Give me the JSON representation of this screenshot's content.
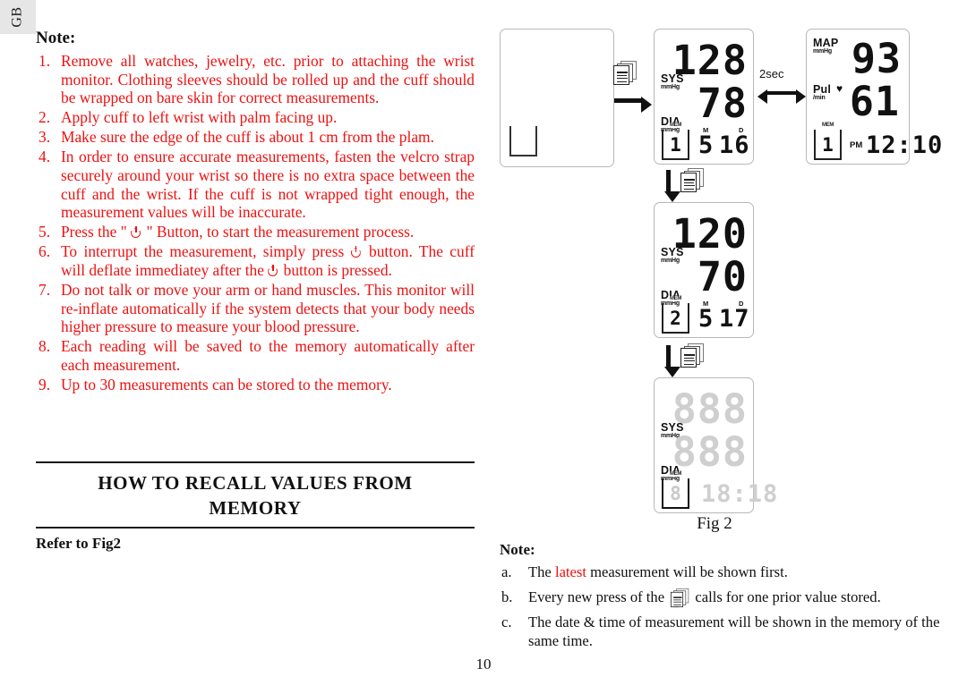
{
  "language_tab": "GB",
  "page_number": "10",
  "left": {
    "note_heading": "Note:",
    "items": [
      {
        "num": "1.",
        "text": "Remove all watches, jewelry, etc. prior to attaching the wrist monitor. Clothing sleeves should be rolled up and the cuff should be wrapped on bare skin for correct measurements."
      },
      {
        "num": "2.",
        "text": "Apply cuff to left wrist with palm facing up."
      },
      {
        "num": "3.",
        "text": "Make sure the edge of the cuff is about 1 cm from the plam."
      },
      {
        "num": "4.",
        "text": "In order to ensure accurate measurements, fasten the velcro strap securely around your wrist so there is no extra space between the cuff and the wrist. If the cuff is not wrapped tight enough, the measurement values will be inaccurate."
      },
      {
        "num": "5.",
        "text_before": "Press the \" ",
        "text_after": " \" Button, to start the measurement process."
      },
      {
        "num": "6.",
        "text_a": "To interrupt the measurement, simply press ",
        "text_b": " button.  The cuff will deflate immediatey after the ",
        "text_c": " button is pressed."
      },
      {
        "num": "7.",
        "text": "Do not talk or move your arm or hand muscles.  This monitor will re-inflate automatically if the system detects that your body needs higher pressure to measure your blood pressure."
      },
      {
        "num": "8.",
        "text": "Each reading will be saved to the memory automatically after each measurement."
      },
      {
        "num": "9.",
        "text": "Up to 30 measurements can be stored to the memory."
      }
    ],
    "section_title_line1": "HOW  TO  RECALL  VALUES  FROM",
    "section_title_line2": "MEMORY",
    "refer": "Refer to Fig2"
  },
  "figure": {
    "caption": "Fig 2",
    "interval_label": "2sec",
    "displays": [
      {
        "id": "blank",
        "mem_label": "",
        "mem_value": ""
      },
      {
        "id": "reading-1",
        "top_label": "SYS",
        "top_unit": "mmHg",
        "top_value": "128",
        "bottom_label": "DIA",
        "bottom_unit": "mmHg",
        "bottom_value": "78",
        "mem_label": "MEM",
        "mem_value": "1",
        "month_label": "M",
        "month_value": "5",
        "day_label": "D",
        "day_value": "16"
      },
      {
        "id": "reading-1-map",
        "top_label": "MAP",
        "top_unit": "mmHg",
        "top_value": "93",
        "bottom_label": "Pul",
        "bottom_unit": "/min",
        "bottom_value": "61",
        "mem_label": "MEM",
        "mem_value": "1",
        "ampm": "PM",
        "time_value": "12:10"
      },
      {
        "id": "reading-2",
        "top_label": "SYS",
        "top_unit": "mmHg",
        "top_value": "120",
        "bottom_label": "DIA",
        "bottom_unit": "mmHg",
        "bottom_value": "70",
        "mem_label": "MEM",
        "mem_value": "2",
        "month_label": "M",
        "month_value": "5",
        "day_label": "D",
        "day_value": "17"
      },
      {
        "id": "all-segments",
        "top_label": "SYS",
        "top_unit": "mmHg",
        "top_value": "888",
        "bottom_label": "DIA",
        "bottom_unit": "mmHg",
        "bottom_value": "888",
        "mem_label": "MEM",
        "mem_value": "8",
        "time_value": "18:18"
      }
    ]
  },
  "bottom_note": {
    "heading": "Note:",
    "items": [
      {
        "num": "a.",
        "pre": "The ",
        "red": "latest",
        "post": " measurement will be shown first."
      },
      {
        "num": "b.",
        "pre": "Every new press of the ",
        "post": " calls for one prior value stored."
      },
      {
        "num": "c.",
        "text": "The date &  time of measurement will be shown in the memory of the same time."
      }
    ]
  },
  "colors": {
    "note_red": "#ee1111",
    "text_black": "#111111",
    "tab_gray": "#e6e6e6",
    "lcd_border": "#b9b6bd",
    "ghost_segment": "#cfcfcf"
  }
}
